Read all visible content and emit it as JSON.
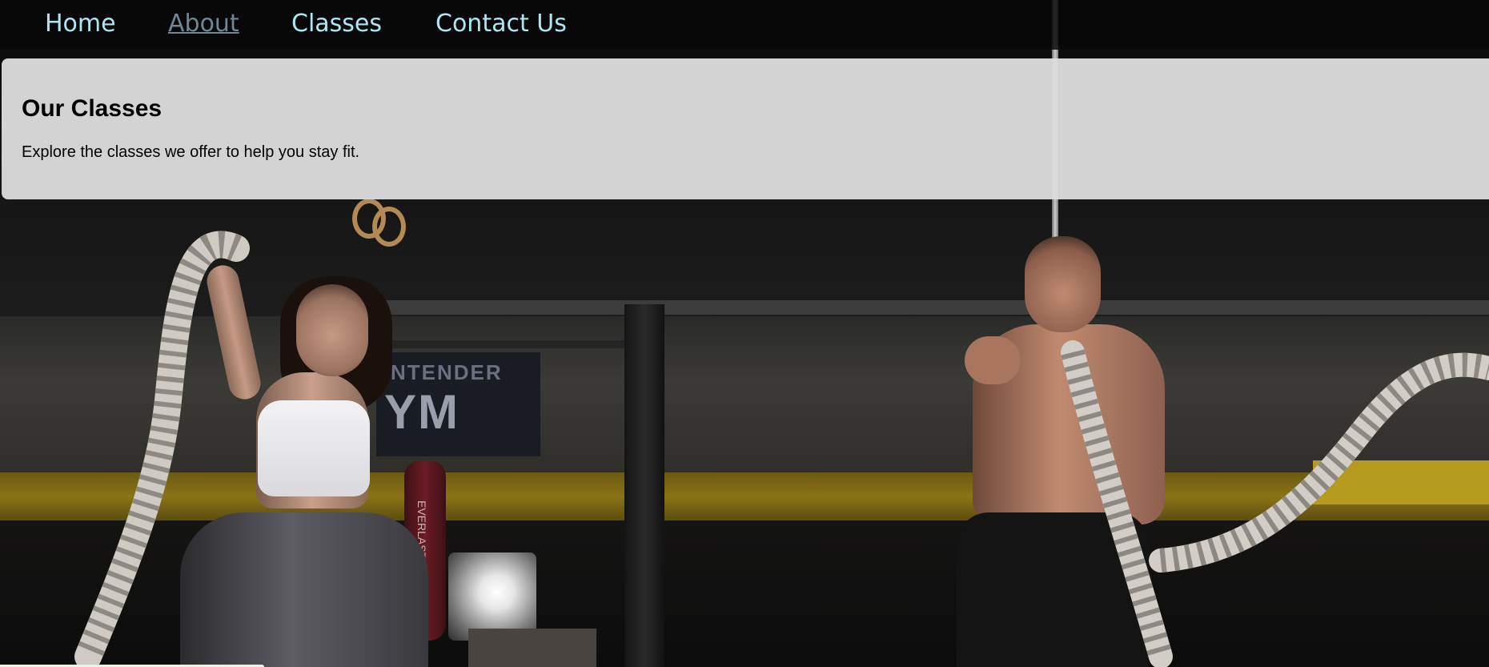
{
  "nav": {
    "items": [
      {
        "label": "Home",
        "active": false
      },
      {
        "label": "About",
        "active": true
      },
      {
        "label": "Classes",
        "active": false
      },
      {
        "label": "Contact Us",
        "active": false
      }
    ]
  },
  "hero": {
    "title": "Our Classes",
    "description": "Explore the classes we offer to help you stay fit.",
    "background": "gym-photo-battle-ropes",
    "sign_text_1": "NTENDER",
    "sign_text_2": "YM",
    "bag_text": "EVERLAST"
  },
  "colors": {
    "nav_link": "#aee6f1",
    "nav_active": "#6f8794",
    "card_bg": "#dcdcdc"
  }
}
